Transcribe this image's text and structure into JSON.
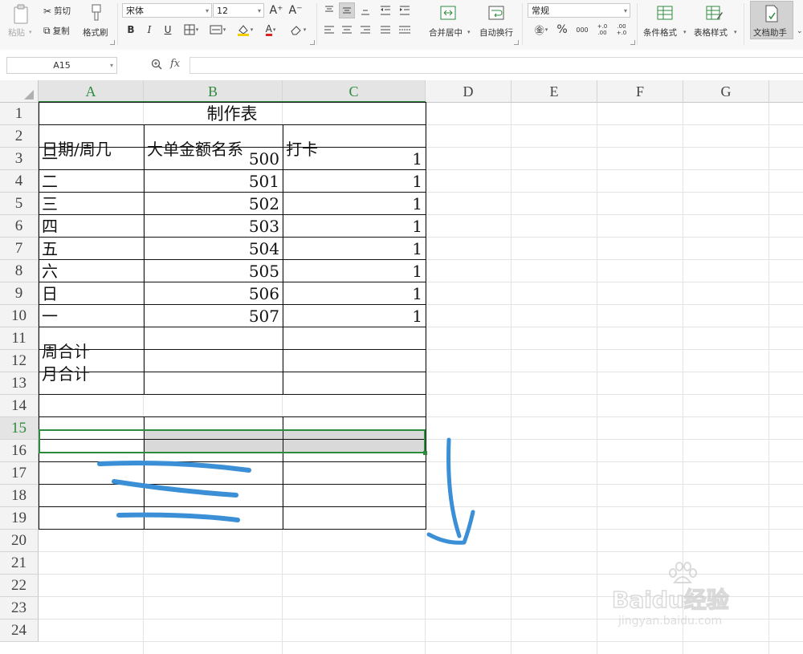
{
  "ribbon": {
    "paste_label": "粘贴",
    "cut_label": "剪切",
    "copy_label": "复制",
    "format_painter_label": "格式刷",
    "font_name": "宋体",
    "font_size": "12",
    "merge_center_label": "合并居中",
    "wrap_text_label": "自动换行",
    "number_format": "常规",
    "percent_symbol": "%",
    "thousands_symbol": "000",
    "inc_decimal": "+.0 .00",
    "dec_decimal": ".00 +.0",
    "cond_format_label": "条件格式",
    "table_style_label": "表格样式",
    "doc_helper_label": "文档助手",
    "bold": "B",
    "italic": "I",
    "underline": "U",
    "font_color_glyph": "A",
    "grow_font": "A⁺",
    "shrink_font": "A⁻"
  },
  "formula_bar": {
    "name_box": "A15",
    "fx_label": "fx",
    "formula": ""
  },
  "sheet": {
    "columns": [
      "A",
      "B",
      "C",
      "D",
      "E",
      "F",
      "G"
    ],
    "rows": [
      "1",
      "2",
      "3",
      "4",
      "5",
      "6",
      "7",
      "8",
      "9",
      "10",
      "11",
      "12",
      "13",
      "14",
      "15",
      "16",
      "17",
      "18",
      "19",
      "20",
      "21",
      "22",
      "23",
      "24"
    ],
    "title": "制作表",
    "headers": [
      "日期/周几",
      "大单金额名系",
      "打卡"
    ],
    "data": [
      [
        "一",
        "500",
        "1"
      ],
      [
        "二",
        "501",
        "1"
      ],
      [
        "三",
        "502",
        "1"
      ],
      [
        "四",
        "503",
        "1"
      ],
      [
        "五",
        "504",
        "1"
      ],
      [
        "六",
        "505",
        "1"
      ],
      [
        "日",
        "506",
        "1"
      ],
      [
        "一",
        "507",
        "1"
      ]
    ],
    "summary": [
      "周合计",
      "月合计"
    ],
    "selected_row": "15",
    "selected_col": "A"
  },
  "colors": {
    "accent_green": "#2e8b3d",
    "annotation_blue": "#3a8fd6",
    "selection_fill": "#d9d9d9"
  },
  "watermark": {
    "logo": "Baidu经验",
    "url": "jingyan.baidu.com"
  }
}
